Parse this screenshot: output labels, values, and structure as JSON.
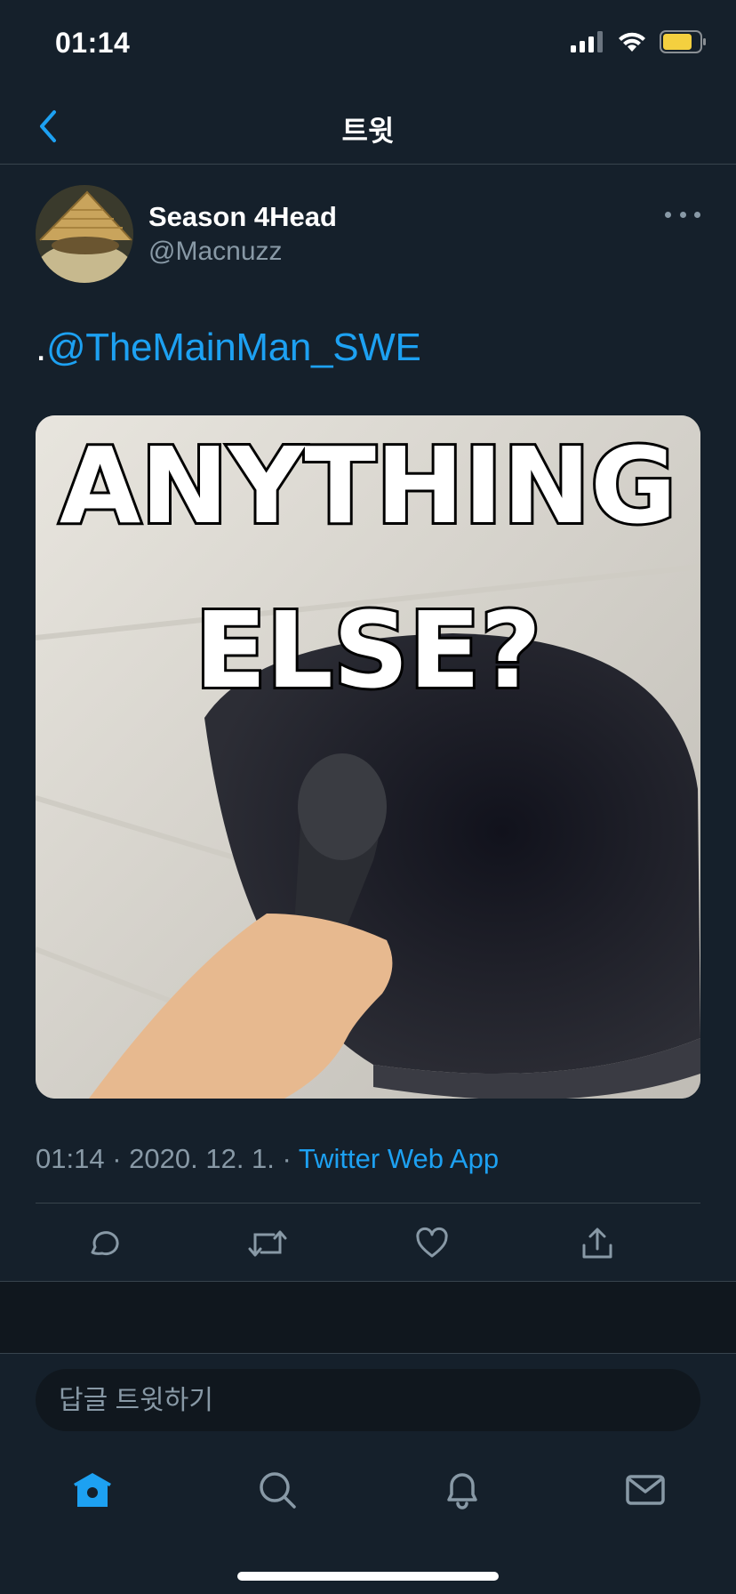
{
  "status_bar": {
    "time": "01:14"
  },
  "nav": {
    "title": "트윗"
  },
  "tweet": {
    "author_name": "Season 4Head",
    "author_handle": "@Macnuzz",
    "text_prefix": ".",
    "mention": "@TheMainMan_SWE",
    "media": {
      "line1": "ANYTHING",
      "line2": "ELSE?"
    },
    "time": "01:14",
    "date": "2020. 12. 1.",
    "separator": "·",
    "source_app": "Twitter Web App"
  },
  "actions": {
    "reply": "reply-icon",
    "retweet": "retweet-icon",
    "like": "heart-icon",
    "share": "share-icon"
  },
  "reply_box": {
    "placeholder": "답글 트윗하기"
  },
  "tab_bar": {
    "items": [
      "home-icon",
      "search-icon",
      "bell-icon",
      "mail-icon"
    ]
  },
  "colors": {
    "background": "#15202b",
    "accent": "#1da1f2",
    "muted": "#8899a6",
    "battery": "#f4d03f"
  }
}
